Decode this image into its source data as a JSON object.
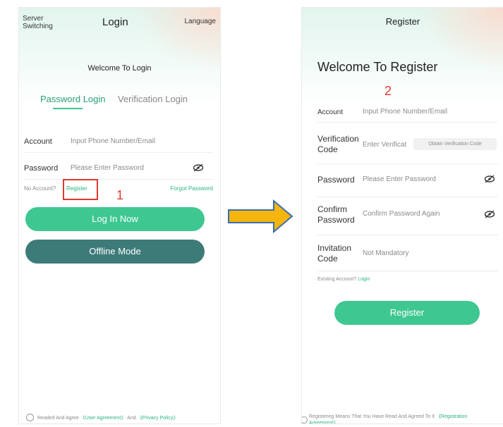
{
  "login": {
    "server_switching": "Server\nSwitching",
    "title": "Login",
    "language": "Language",
    "welcome": "Welcome To Login",
    "tabs": [
      "Password Login",
      "Verification Login"
    ],
    "account_label": "Account",
    "account_placeholder": "Input Phone Number/Email",
    "password_label": "Password",
    "password_placeholder": "Please Enter Password",
    "no_account": "No Account?",
    "register_link": "Register",
    "forgot": "Forgot Password",
    "login_button": "Log In Now",
    "offline_button": "Offline Mode",
    "agreement_prefix": "Readed And Agree",
    "user_agreement": "《User Agreement》",
    "and": "And",
    "privacy_policy": "《Privacy Policy》",
    "annotation": "1"
  },
  "register": {
    "title": "Register",
    "welcome": "Welcome To Register",
    "annotation": "2",
    "account_label": "Account",
    "account_placeholder": "Input Phone Number/Email",
    "verification_label": "Verification\nCode",
    "verification_placeholder": "Enter Verificat",
    "obtain_code": "Obtain Verification Code",
    "password_label": "Password",
    "password_placeholder": "Please Enter Password",
    "confirm_label": "Confirm\nPassword",
    "confirm_placeholder": "Confirm Password Again",
    "invitation_label": "Invitation\nCode",
    "invitation_placeholder": "Not Mandatory",
    "existing_account": "Existing Account?",
    "login_link": "Login",
    "register_button": "Register",
    "agreement_text": "Registering Means That You Have Read And Agreed To It",
    "registration_agreement": "《Registration\nAgreement》"
  },
  "colors": {
    "accent": "#3fc792",
    "dark_button": "#3d7b79",
    "annotation_red": "#e03a2f",
    "arrow": "#f5b50d",
    "arrow_stroke": "#3b6db3"
  },
  "icons": [
    "eye-off-icon",
    "radio-circle-icon",
    "arrow-right-icon"
  ]
}
